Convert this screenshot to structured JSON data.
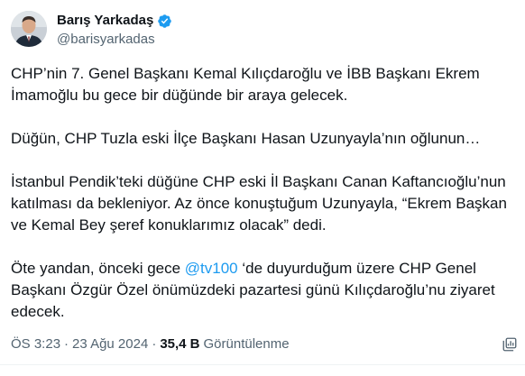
{
  "author": {
    "display_name": "Barış Yarkadaş",
    "handle": "@barisyarkadas",
    "verified": true
  },
  "tweet": {
    "p1": "CHP’nin 7. Genel Başkanı Kemal Kılıçdaroğlu ve İBB Başkanı Ekrem İmamoğlu bu gece bir düğünde bir araya gelecek.",
    "p2": "Düğün, CHP Tuzla eski İlçe Başkanı Hasan Uzunyayla’nın oğlunun…",
    "p3": "İstanbul Pendik’teki düğüne CHP eski İl Başkanı Canan Kaftancıoğlu’nun katılması da bekleniyor. Az önce konuştuğum Uzunyayla, “Ekrem Başkan ve Kemal Bey şeref konuklarımız olacak” dedi.",
    "p4_before": "Öte yandan, önceki gece ",
    "p4_mention": "@tv100",
    "p4_after": " ‘de duyurduğum üzere CHP Genel Başkanı Özgür Özel önümüzdeki pazartesi günü Kılıçdaroğlu’nu ziyaret edecek."
  },
  "meta": {
    "time": "ÖS 3:23",
    "separator1": "·",
    "date": "23 Ağu 2024",
    "separator2": "·",
    "views_count": "35,4 B",
    "views_label": "Görüntülenme"
  },
  "icons": {
    "verified": "verified-badge-icon",
    "analytics": "analytics-icon"
  },
  "colors": {
    "text": "#0f1419",
    "secondary": "#536471",
    "accent": "#1d9bf0"
  }
}
